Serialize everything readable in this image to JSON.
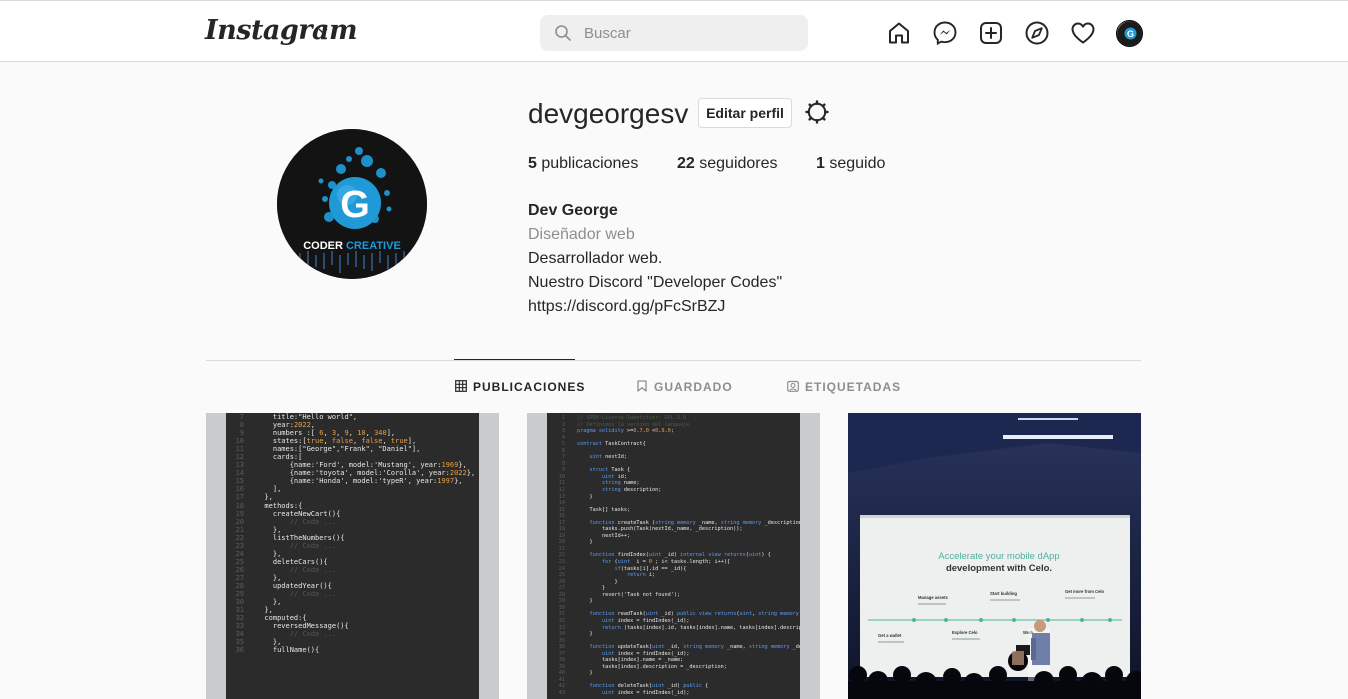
{
  "header": {
    "logo_text": "Instagram",
    "search_placeholder": "Buscar",
    "nav_icons": [
      "home-icon",
      "messenger-icon",
      "new-post-icon",
      "explore-icon",
      "activity-heart-icon",
      "profile-avatar"
    ]
  },
  "profile": {
    "username": "devgeorgesv",
    "edit_label": "Editar perfil",
    "stats": {
      "posts_count": "5",
      "posts_label": "publicaciones",
      "followers_count": "22",
      "followers_label": "seguidores",
      "following_count": "1",
      "following_label": "seguido"
    },
    "bio": {
      "name": "Dev George",
      "category": "Diseñador web",
      "line1": "Desarrollador web.",
      "line2": "Nuestro Discord \"Developer Codes\"",
      "link": "https://discord.gg/pFcSrBZJ"
    },
    "avatar": {
      "letter": "G",
      "brand_a": "CODER ",
      "brand_b": "CREATIVE"
    }
  },
  "tabs": [
    {
      "label": "PUBLICACIONES",
      "active": true,
      "icon": "grid-icon"
    },
    {
      "label": "GUARDADO",
      "active": false,
      "icon": "bookmark-icon"
    },
    {
      "label": "ETIQUETADAS",
      "active": false,
      "icon": "tagged-icon"
    }
  ],
  "posts": {
    "post1_lines": [
      {
        "n": "7",
        "t": "    title:\"Hello world\","
      },
      {
        "n": "8",
        "t": "    year:2022,"
      },
      {
        "n": "9",
        "t": "    numbers :[ 6, 3, 9, 10, 340],"
      },
      {
        "n": "10",
        "t": "    states:[true, false, false, true],"
      },
      {
        "n": "11",
        "t": "    names:[\"George\",\"Frank\", \"Daniel\"],"
      },
      {
        "n": "12",
        "t": "    cards:["
      },
      {
        "n": "13",
        "t": "        {name:'Ford', model:'Mustang', year:1969},"
      },
      {
        "n": "14",
        "t": "        {name:'toyota', model:'Corolla', year:2022},"
      },
      {
        "n": "15",
        "t": "        {name:'Honda', model:'typeR', year:1997},"
      },
      {
        "n": "16",
        "t": "    ],"
      },
      {
        "n": "17",
        "t": "  },"
      },
      {
        "n": "18",
        "t": "  methods:{"
      },
      {
        "n": "19",
        "t": "    createNewCart(){"
      },
      {
        "n": "20",
        "t": "        // Code ..."
      },
      {
        "n": "21",
        "t": "    },"
      },
      {
        "n": "22",
        "t": "    listTheNumbers(){"
      },
      {
        "n": "23",
        "t": "        // Code ..."
      },
      {
        "n": "24",
        "t": "    },"
      },
      {
        "n": "25",
        "t": "    deleteCars(){"
      },
      {
        "n": "26",
        "t": "        // Code ..."
      },
      {
        "n": "27",
        "t": "    },"
      },
      {
        "n": "28",
        "t": "    updatedYear(){"
      },
      {
        "n": "29",
        "t": "        // Code ..."
      },
      {
        "n": "30",
        "t": "    },"
      },
      {
        "n": "31",
        "t": "  },"
      },
      {
        "n": "32",
        "t": "  computed:{"
      },
      {
        "n": "33",
        "t": "    reversedMessage(){"
      },
      {
        "n": "34",
        "t": "        // Code ..."
      },
      {
        "n": "35",
        "t": "    },"
      },
      {
        "n": "36",
        "t": "    fullName(){"
      }
    ],
    "post2_lines": [
      {
        "n": "1",
        "t": "// SPDX-License-Identifier: GPL-3.0"
      },
      {
        "n": "2",
        "t": "// Definimos la version del lenguaje"
      },
      {
        "n": "3",
        "t": "pragma solidity >=0.7.0 <0.9.0;"
      },
      {
        "n": "4",
        "t": ""
      },
      {
        "n": "5",
        "t": "contract TaskContract{"
      },
      {
        "n": "6",
        "t": ""
      },
      {
        "n": "7",
        "t": "    uint nextId;"
      },
      {
        "n": "8",
        "t": ""
      },
      {
        "n": "9",
        "t": "    struct Task {"
      },
      {
        "n": "10",
        "t": "        uint id;"
      },
      {
        "n": "11",
        "t": "        string name;"
      },
      {
        "n": "12",
        "t": "        string description;"
      },
      {
        "n": "13",
        "t": "    }"
      },
      {
        "n": "14",
        "t": ""
      },
      {
        "n": "15",
        "t": "    Task[] tasks;"
      },
      {
        "n": "16",
        "t": ""
      },
      {
        "n": "17",
        "t": "    function createTask (string memory _name, string memory _description) public {"
      },
      {
        "n": "18",
        "t": "        tasks.push(Task(nextId,_name, _description));"
      },
      {
        "n": "19",
        "t": "        nextId++;"
      },
      {
        "n": "20",
        "t": "    }"
      },
      {
        "n": "21",
        "t": ""
      },
      {
        "n": "22",
        "t": "    function findIndex(uint _id) internal view returns(uint) {"
      },
      {
        "n": "23",
        "t": "        for (uint  i = 0 ; i< tasks.length; i++){"
      },
      {
        "n": "24",
        "t": "            if(tasks[i].id == _id){"
      },
      {
        "n": "25",
        "t": "                return i;"
      },
      {
        "n": "26",
        "t": "            }"
      },
      {
        "n": "27",
        "t": "        }"
      },
      {
        "n": "28",
        "t": "        revert('Task not found');"
      },
      {
        "n": "29",
        "t": "    }"
      },
      {
        "n": "30",
        "t": ""
      },
      {
        "n": "31",
        "t": "    function readTask(uint _id) public view returns(uint, string memory, string memory) {"
      },
      {
        "n": "32",
        "t": "        uint index = findIndex(_id);"
      },
      {
        "n": "33",
        "t": "        return (tasks[index].id, tasks[index].name, tasks[index].description);"
      },
      {
        "n": "34",
        "t": "    }"
      },
      {
        "n": "35",
        "t": ""
      },
      {
        "n": "36",
        "t": "    function updateTask(uint _id, string memory _name, string memory _description) public{"
      },
      {
        "n": "37",
        "t": "        uint index = findIndex(_id);"
      },
      {
        "n": "38",
        "t": "        tasks[index].name = _name;"
      },
      {
        "n": "39",
        "t": "        tasks[index].description = _description;"
      },
      {
        "n": "40",
        "t": "    }"
      },
      {
        "n": "41",
        "t": ""
      },
      {
        "n": "42",
        "t": "    function deleteTask(uint _id) public {"
      },
      {
        "n": "43",
        "t": "        uint index = findIndex(_id);"
      }
    ],
    "post3": {
      "slide_title_a": "Accelerate your mobile dApp",
      "slide_title_b": "development with Celo.",
      "steps": [
        "Manage assets",
        "Start building",
        "Get more from Celo",
        "Get a wallet",
        "Explore Celo",
        "Work"
      ]
    }
  },
  "colors": {
    "text": "#262626",
    "muted": "#8e8e8e",
    "border": "#dbdbdb",
    "background": "#fafafa",
    "accent": "#1f9ad6"
  }
}
